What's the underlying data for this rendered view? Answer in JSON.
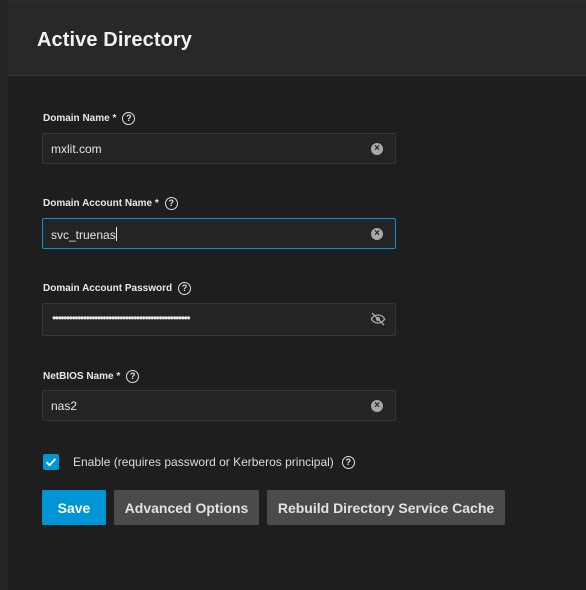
{
  "page": {
    "title": "Active Directory"
  },
  "form": {
    "domain_name": {
      "label": "Domain Name *",
      "value": "mxlit.com"
    },
    "domain_account_name": {
      "label": "Domain Account Name *",
      "value": "svc_truenas"
    },
    "domain_account_password": {
      "label": "Domain Account Password",
      "masked_value": "•••••••••••••••••••••••••••••••••••••••••••••••••"
    },
    "netbios_name": {
      "label": "NetBIOS Name *",
      "value": "nas2"
    },
    "enable": {
      "label": "Enable (requires password or Kerberos principal)",
      "checked": true
    }
  },
  "buttons": {
    "save": "Save",
    "advanced": "Advanced Options",
    "rebuild": "Rebuild Directory Service Cache"
  },
  "colors": {
    "accent": "#0095d5",
    "background": "#1e1e1e",
    "header": "#282828",
    "secondary_button": "#4b4b4b"
  },
  "icons": {
    "help": "question-circle-icon",
    "clear": "clear-circle-icon",
    "visibility": "eye-off-icon",
    "check": "check-icon"
  }
}
